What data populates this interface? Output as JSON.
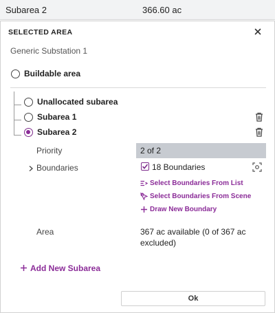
{
  "table_row": {
    "name": "Subarea 2",
    "value": "366.60 ac"
  },
  "panel": {
    "title": "SELECTED AREA",
    "subtitle": "Generic Substation 1",
    "buildable_label": "Buildable area",
    "subareas": [
      {
        "label": "Unallocated subarea",
        "selected": false,
        "deletable": false
      },
      {
        "label": "Subarea 1",
        "selected": false,
        "deletable": true
      },
      {
        "label": "Subarea 2",
        "selected": true,
        "deletable": true
      }
    ],
    "priority_label": "Priority",
    "priority_value": "2 of 2",
    "boundaries_label": "Boundaries",
    "boundaries_count": "18 Boundaries",
    "boundaries_checked": true,
    "actions": {
      "select_from_list": "Select Boundaries From List",
      "select_from_scene": "Select Boundaries From Scene",
      "draw_new": "Draw New Boundary"
    },
    "area_label": "Area",
    "area_value": "367 ac available (0 of 367 ac excluded)",
    "add_subarea": "Add New Subarea",
    "ok_label": "Ok"
  },
  "colors": {
    "accent": "#8b2c98",
    "priority_bg": "#c7cbd1",
    "top_row_bg": "#f2f3f4"
  },
  "icons": {
    "close": "close-icon",
    "trash": "trash-icon",
    "chevron": "chevron-right-icon",
    "focus": "focus-frame-icon",
    "list": "list-select-icon",
    "scene": "cursor-select-icon",
    "plus": "plus-icon"
  }
}
